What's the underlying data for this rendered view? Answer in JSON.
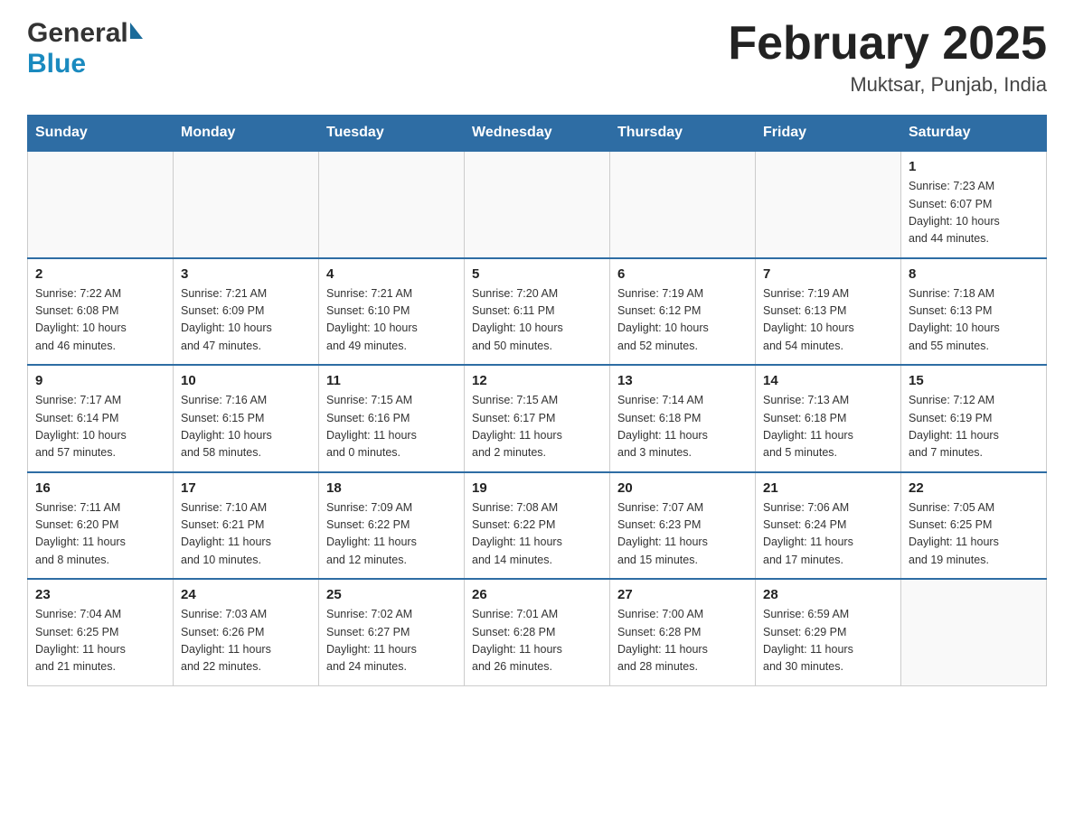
{
  "header": {
    "logo_general": "General",
    "logo_blue": "Blue",
    "month_year": "February 2025",
    "location": "Muktsar, Punjab, India"
  },
  "days_of_week": [
    "Sunday",
    "Monday",
    "Tuesday",
    "Wednesday",
    "Thursday",
    "Friday",
    "Saturday"
  ],
  "weeks": [
    {
      "days": [
        {
          "num": "",
          "info": ""
        },
        {
          "num": "",
          "info": ""
        },
        {
          "num": "",
          "info": ""
        },
        {
          "num": "",
          "info": ""
        },
        {
          "num": "",
          "info": ""
        },
        {
          "num": "",
          "info": ""
        },
        {
          "num": "1",
          "info": "Sunrise: 7:23 AM\nSunset: 6:07 PM\nDaylight: 10 hours\nand 44 minutes."
        }
      ]
    },
    {
      "days": [
        {
          "num": "2",
          "info": "Sunrise: 7:22 AM\nSunset: 6:08 PM\nDaylight: 10 hours\nand 46 minutes."
        },
        {
          "num": "3",
          "info": "Sunrise: 7:21 AM\nSunset: 6:09 PM\nDaylight: 10 hours\nand 47 minutes."
        },
        {
          "num": "4",
          "info": "Sunrise: 7:21 AM\nSunset: 6:10 PM\nDaylight: 10 hours\nand 49 minutes."
        },
        {
          "num": "5",
          "info": "Sunrise: 7:20 AM\nSunset: 6:11 PM\nDaylight: 10 hours\nand 50 minutes."
        },
        {
          "num": "6",
          "info": "Sunrise: 7:19 AM\nSunset: 6:12 PM\nDaylight: 10 hours\nand 52 minutes."
        },
        {
          "num": "7",
          "info": "Sunrise: 7:19 AM\nSunset: 6:13 PM\nDaylight: 10 hours\nand 54 minutes."
        },
        {
          "num": "8",
          "info": "Sunrise: 7:18 AM\nSunset: 6:13 PM\nDaylight: 10 hours\nand 55 minutes."
        }
      ]
    },
    {
      "days": [
        {
          "num": "9",
          "info": "Sunrise: 7:17 AM\nSunset: 6:14 PM\nDaylight: 10 hours\nand 57 minutes."
        },
        {
          "num": "10",
          "info": "Sunrise: 7:16 AM\nSunset: 6:15 PM\nDaylight: 10 hours\nand 58 minutes."
        },
        {
          "num": "11",
          "info": "Sunrise: 7:15 AM\nSunset: 6:16 PM\nDaylight: 11 hours\nand 0 minutes."
        },
        {
          "num": "12",
          "info": "Sunrise: 7:15 AM\nSunset: 6:17 PM\nDaylight: 11 hours\nand 2 minutes."
        },
        {
          "num": "13",
          "info": "Sunrise: 7:14 AM\nSunset: 6:18 PM\nDaylight: 11 hours\nand 3 minutes."
        },
        {
          "num": "14",
          "info": "Sunrise: 7:13 AM\nSunset: 6:18 PM\nDaylight: 11 hours\nand 5 minutes."
        },
        {
          "num": "15",
          "info": "Sunrise: 7:12 AM\nSunset: 6:19 PM\nDaylight: 11 hours\nand 7 minutes."
        }
      ]
    },
    {
      "days": [
        {
          "num": "16",
          "info": "Sunrise: 7:11 AM\nSunset: 6:20 PM\nDaylight: 11 hours\nand 8 minutes."
        },
        {
          "num": "17",
          "info": "Sunrise: 7:10 AM\nSunset: 6:21 PM\nDaylight: 11 hours\nand 10 minutes."
        },
        {
          "num": "18",
          "info": "Sunrise: 7:09 AM\nSunset: 6:22 PM\nDaylight: 11 hours\nand 12 minutes."
        },
        {
          "num": "19",
          "info": "Sunrise: 7:08 AM\nSunset: 6:22 PM\nDaylight: 11 hours\nand 14 minutes."
        },
        {
          "num": "20",
          "info": "Sunrise: 7:07 AM\nSunset: 6:23 PM\nDaylight: 11 hours\nand 15 minutes."
        },
        {
          "num": "21",
          "info": "Sunrise: 7:06 AM\nSunset: 6:24 PM\nDaylight: 11 hours\nand 17 minutes."
        },
        {
          "num": "22",
          "info": "Sunrise: 7:05 AM\nSunset: 6:25 PM\nDaylight: 11 hours\nand 19 minutes."
        }
      ]
    },
    {
      "days": [
        {
          "num": "23",
          "info": "Sunrise: 7:04 AM\nSunset: 6:25 PM\nDaylight: 11 hours\nand 21 minutes."
        },
        {
          "num": "24",
          "info": "Sunrise: 7:03 AM\nSunset: 6:26 PM\nDaylight: 11 hours\nand 22 minutes."
        },
        {
          "num": "25",
          "info": "Sunrise: 7:02 AM\nSunset: 6:27 PM\nDaylight: 11 hours\nand 24 minutes."
        },
        {
          "num": "26",
          "info": "Sunrise: 7:01 AM\nSunset: 6:28 PM\nDaylight: 11 hours\nand 26 minutes."
        },
        {
          "num": "27",
          "info": "Sunrise: 7:00 AM\nSunset: 6:28 PM\nDaylight: 11 hours\nand 28 minutes."
        },
        {
          "num": "28",
          "info": "Sunrise: 6:59 AM\nSunset: 6:29 PM\nDaylight: 11 hours\nand 30 minutes."
        },
        {
          "num": "",
          "info": ""
        }
      ]
    }
  ]
}
